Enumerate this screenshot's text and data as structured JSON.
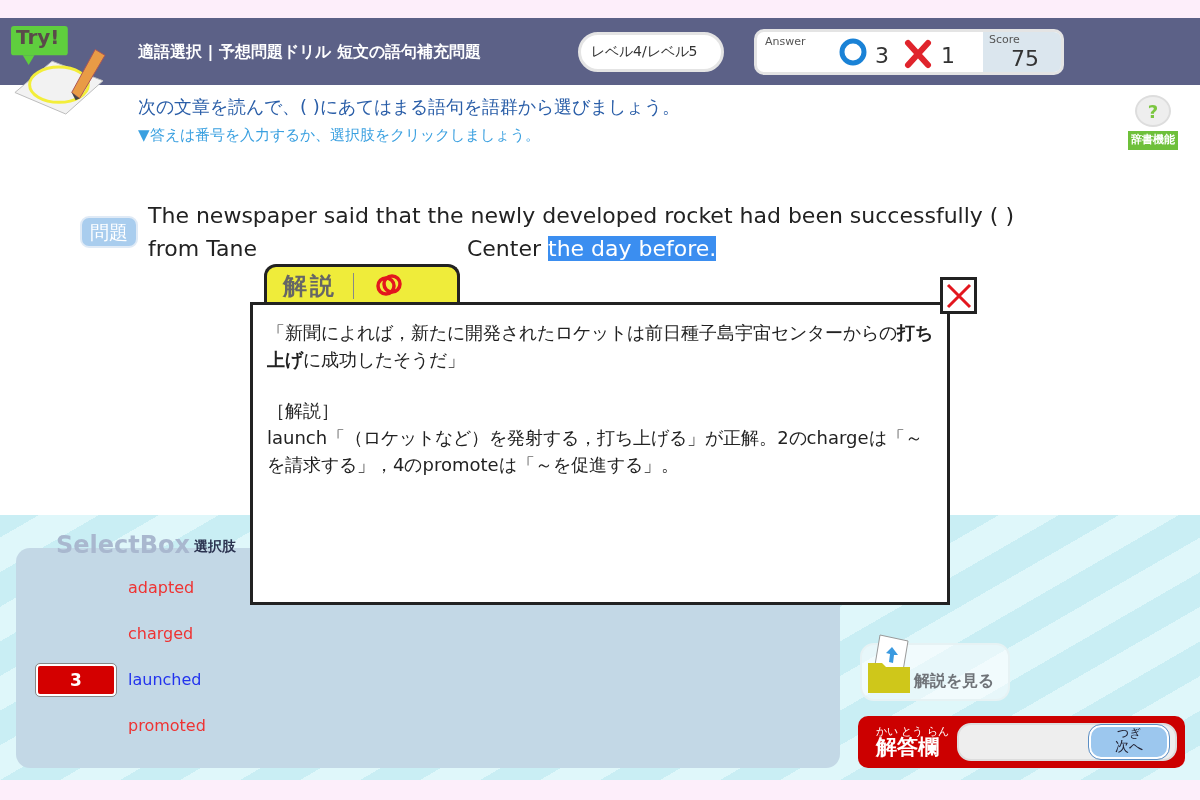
{
  "header": {
    "logo_text": "Try!",
    "title": "適語選択 | 予想問題ドリル 短文の語句補充問題",
    "level": "レベル4/レベル5",
    "score_panel": {
      "answer_label": "Answer",
      "correct_count": "3",
      "wrong_count": "1",
      "score_label": "Score",
      "score": "75"
    }
  },
  "instructions": {
    "main": "次の文章を読んで、( )にあてはまる語句を語群から選びましょう。",
    "hint": "▼答えは番号を入力するか、選択肢をクリックしましょう。"
  },
  "help": {
    "label": "辞書機能",
    "mark": "?"
  },
  "question": {
    "badge": "問題",
    "line_1": "The newspaper said that the newly developed rocket had been successfully ( )",
    "line_2_start": "from Tane",
    "line_2_end": "Center",
    "highlighted": "the day before."
  },
  "select_box": {
    "title": "SelectBox",
    "subtitle": "選択肢",
    "choices": [
      {
        "label": "adapted",
        "selected": false
      },
      {
        "label": "charged",
        "selected": false
      },
      {
        "label": "launched",
        "selected": true,
        "number": "3"
      },
      {
        "label": "promoted",
        "selected": false
      }
    ]
  },
  "view_explanation_button": "解説を見る",
  "answer_bar": {
    "label": "解答欄",
    "ruby": "かい とう らん",
    "next_button": "次へ",
    "next_ruby": "つぎ"
  },
  "explanation_popup": {
    "tab": "解説",
    "translation": "「新聞によれば，新たに開発されたロケットは前日種子島宇宙センターからの**打ち上げ**に成功したそうだ」",
    "heading": "［解説］",
    "body": "launch「（ロケットなど）を発射する，打ち上げる」が正解。2のchargeは「～を請求する」，4のpromoteは「～を促進する」。"
  }
}
